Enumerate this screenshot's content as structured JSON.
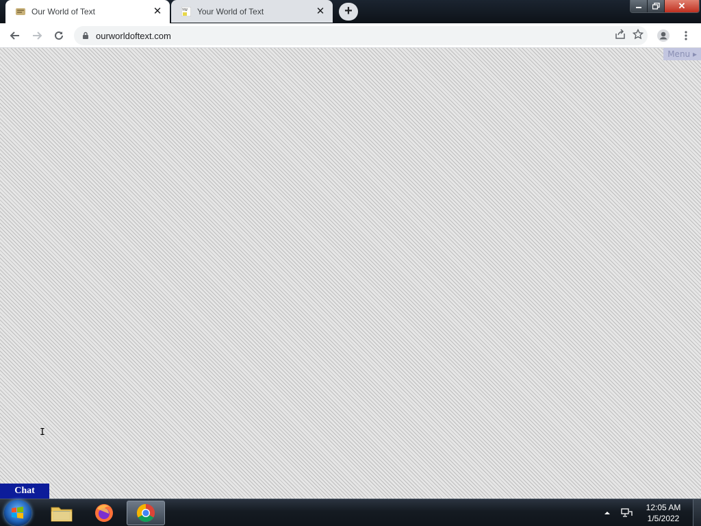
{
  "browser": {
    "tabs": [
      {
        "title": "Our World of Text",
        "active": true
      },
      {
        "title": "Your World of Text",
        "active": false
      }
    ],
    "address": "ourworldoftext.com"
  },
  "page": {
    "menu_label": "Menu ▸",
    "chat_label": "Chat",
    "pattern_colors": [
      "#bdbdbd",
      "#e6e6e6"
    ]
  },
  "taskbar": {
    "apps": [
      "start-orb",
      "file-explorer-icon",
      "firefox-icon",
      "chrome-icon"
    ],
    "time": "12:05 AM",
    "date": "1/5/2022"
  }
}
